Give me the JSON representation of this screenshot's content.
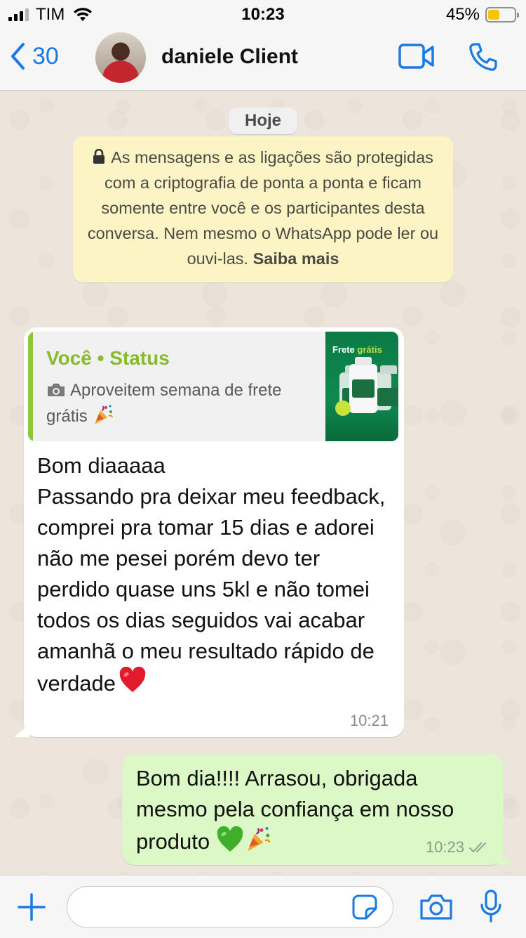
{
  "status_bar": {
    "carrier": "TIM",
    "time": "10:23",
    "battery_percent": "45%",
    "battery_level": 0.45,
    "battery_color": "#f8c300"
  },
  "header": {
    "back_count": "30",
    "contact_name": "daniele Client",
    "icons": [
      "chevron-left-icon",
      "video-call-icon",
      "phone-icon"
    ],
    "accent_color": "#1a7ae4"
  },
  "chat": {
    "date_label": "Hoje",
    "encryption_notice": {
      "text": "As mensagens e as ligações são protegidas com a criptografia de ponta a ponta e ficam somente entre você e os participantes desta conversa. Nem mesmo o WhatsApp pode ler ou ouvi-las.",
      "link": "Saiba mais"
    },
    "incoming": {
      "quote_author": "Você • Status",
      "quote_text": "Aproveitem semana de frete grátis",
      "quote_emoji": "party-popper-icon",
      "thumb_title_main": "Frete ",
      "thumb_title_accent": "grátis",
      "thumb_brand": "G&G",
      "body": "Bom diaaaaa\nPassando pra deixar meu feedback, comprei pra tomar 15 dias e adorei não me pesei porém devo ter perdido quase uns 5kl  e não tomei todos os dias seguidos vai acabar amanhã o meu resultado rápido de verdade",
      "body_emoji": "red-heart-icon",
      "time": "10:21"
    },
    "outgoing": {
      "body": "Bom dia!!!! Arrasou, obrigada mesmo pela confiança em nosso produto",
      "body_emojis": [
        "green-heart-icon",
        "party-popper-icon"
      ],
      "time": "10:23",
      "status": "read"
    }
  },
  "composer": {
    "placeholder": "",
    "icons": [
      "plus-icon",
      "sticker-icon",
      "camera-icon",
      "microphone-icon"
    ]
  }
}
